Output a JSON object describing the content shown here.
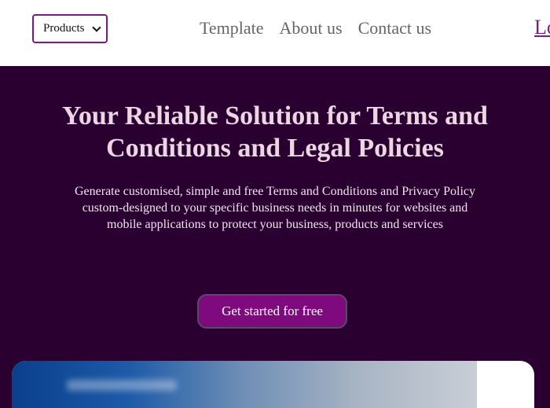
{
  "header": {
    "products_select": {
      "selected": "Products"
    },
    "nav": [
      "Template",
      "About us",
      "Contact us"
    ],
    "login_partial": "Lo"
  },
  "hero": {
    "title": "Your Reliable Solution for Terms and Conditions and Legal Policies",
    "description": "Generate customised, simple and free Terms and Conditions and Privacy Policy custom-designed to your specific business needs in minutes for websites and mobile applications to protect your business, products and services",
    "cta_label": "Get started for free"
  },
  "colors": {
    "hero_bg": "#2a0030",
    "accent": "#7e0a7e",
    "select_border": "#7a1a80"
  }
}
